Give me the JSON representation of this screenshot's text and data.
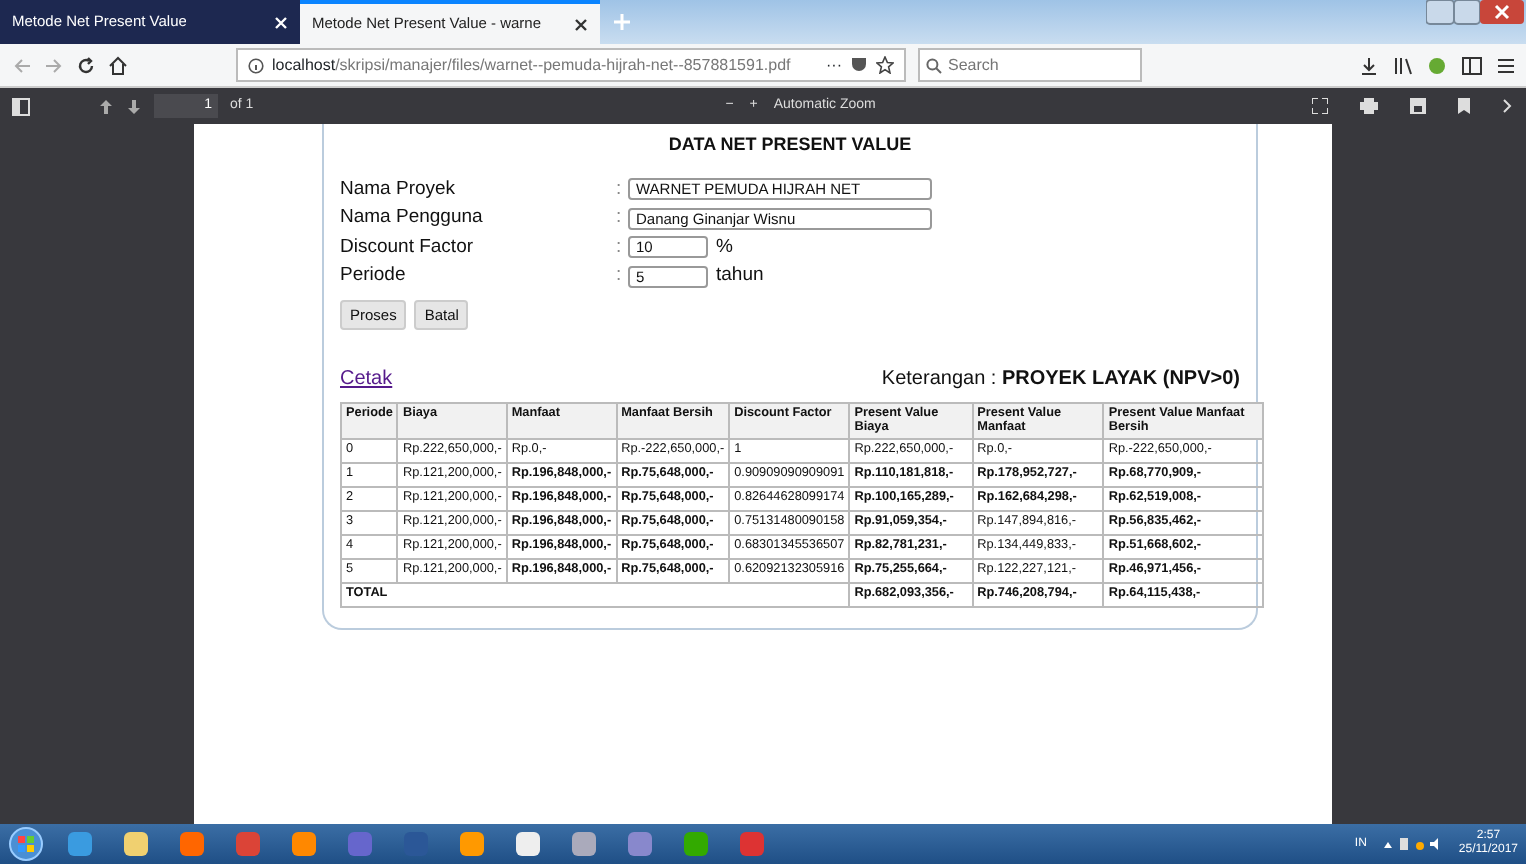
{
  "browser": {
    "tabs": [
      {
        "title": "Metode Net Present Value",
        "selected": false
      },
      {
        "title": "Metode Net Present Value - warne",
        "selected": true
      }
    ],
    "url_host": "localhost",
    "url_path": "/skripsi/manajer/files/warnet--pemuda-hijrah-net--857881591.pdf",
    "more": "···",
    "search": {
      "placeholder": "Search"
    }
  },
  "pdf_toolbar": {
    "page": "1",
    "of": "of 1",
    "minus": "−",
    "plus": "+",
    "zoom": "Automatic Zoom"
  },
  "document": {
    "title": "DATA NET PRESENT VALUE",
    "fields": [
      {
        "label": "Nama Proyek",
        "colon": ":",
        "value": "WARNET PEMUDA HIJRAH NET",
        "kind": "wide"
      },
      {
        "label": "Nama Pengguna",
        "colon": ":",
        "value": "Danang Ginanjar Wisnu",
        "kind": "wide"
      },
      {
        "label": "Discount Factor",
        "colon": ":",
        "value": "10",
        "kind": "short",
        "unit": "%"
      },
      {
        "label": "Periode",
        "colon": ":",
        "value": "5",
        "kind": "short",
        "unit": "tahun"
      }
    ],
    "buttons": [
      "Proses",
      "Batal"
    ],
    "print_link": "Cetak",
    "note_label": "Keterangan :",
    "note_value": "PROYEK LAYAK (NPV>0)",
    "table": {
      "columns": [
        "Periode",
        "Biaya",
        "Manfaat",
        "Manfaat Bersih",
        "Discount Factor",
        "Present Value Biaya",
        "Present Value Manfaat",
        "Present Value Manfaat Bersih"
      ],
      "rows": [
        [
          {
            "text": "0",
            "bold": false
          },
          {
            "text": "Rp.222,650,000,-",
            "bold": false
          },
          {
            "text": "Rp.0,-",
            "bold": false
          },
          {
            "text": "Rp.-222,650,000,-",
            "bold": false
          },
          {
            "text": "1",
            "bold": false
          },
          {
            "text": "Rp.222,650,000,-",
            "bold": false
          },
          {
            "text": "Rp.0,-",
            "bold": false
          },
          {
            "text": "Rp.-222,650,000,-",
            "bold": false
          }
        ],
        [
          {
            "text": "1",
            "bold": false
          },
          {
            "text": "Rp.121,200,000,-",
            "bold": false
          },
          {
            "text": "Rp.196,848,000,-",
            "bold": true
          },
          {
            "text": "Rp.75,648,000,-",
            "bold": true
          },
          {
            "text": "0.90909090909091",
            "bold": false
          },
          {
            "text": "Rp.110,181,818,-",
            "bold": true
          },
          {
            "text": "Rp.178,952,727,-",
            "bold": true
          },
          {
            "text": "Rp.68,770,909,-",
            "bold": true
          }
        ],
        [
          {
            "text": "2",
            "bold": false
          },
          {
            "text": "Rp.121,200,000,-",
            "bold": false
          },
          {
            "text": "Rp.196,848,000,-",
            "bold": true
          },
          {
            "text": "Rp.75,648,000,-",
            "bold": true
          },
          {
            "text": "0.82644628099174",
            "bold": false
          },
          {
            "text": "Rp.100,165,289,-",
            "bold": true
          },
          {
            "text": "Rp.162,684,298,-",
            "bold": true
          },
          {
            "text": "Rp.62,519,008,-",
            "bold": true
          }
        ],
        [
          {
            "text": "3",
            "bold": false
          },
          {
            "text": "Rp.121,200,000,-",
            "bold": false
          },
          {
            "text": "Rp.196,848,000,-",
            "bold": true
          },
          {
            "text": "Rp.75,648,000,-",
            "bold": true
          },
          {
            "text": "0.75131480090158",
            "bold": false
          },
          {
            "text": "Rp.91,059,354,-",
            "bold": true
          },
          {
            "text": "Rp.147,894,816,-",
            "bold": false
          },
          {
            "text": "Rp.56,835,462,-",
            "bold": true
          }
        ],
        [
          {
            "text": "4",
            "bold": false
          },
          {
            "text": "Rp.121,200,000,-",
            "bold": false
          },
          {
            "text": "Rp.196,848,000,-",
            "bold": true
          },
          {
            "text": "Rp.75,648,000,-",
            "bold": true
          },
          {
            "text": "0.68301345536507",
            "bold": false
          },
          {
            "text": "Rp.82,781,231,-",
            "bold": true
          },
          {
            "text": "Rp.134,449,833,-",
            "bold": false
          },
          {
            "text": "Rp.51,668,602,-",
            "bold": true
          }
        ],
        [
          {
            "text": "5",
            "bold": false
          },
          {
            "text": "Rp.121,200,000,-",
            "bold": false
          },
          {
            "text": "Rp.196,848,000,-",
            "bold": true
          },
          {
            "text": "Rp.75,648,000,-",
            "bold": true
          },
          {
            "text": "0.62092132305916",
            "bold": false
          },
          {
            "text": "Rp.75,255,664,-",
            "bold": true
          },
          {
            "text": "Rp.122,227,121,-",
            "bold": false
          },
          {
            "text": "Rp.46,971,456,-",
            "bold": true
          }
        ]
      ],
      "total": {
        "label": "TOTAL",
        "values": [
          "Rp.682,093,356,-",
          "Rp.746,208,794,-",
          "Rp.64,115,438,-"
        ]
      }
    }
  },
  "taskbar": {
    "language": "IN",
    "time": "2:57",
    "date": "25/11/2017"
  }
}
